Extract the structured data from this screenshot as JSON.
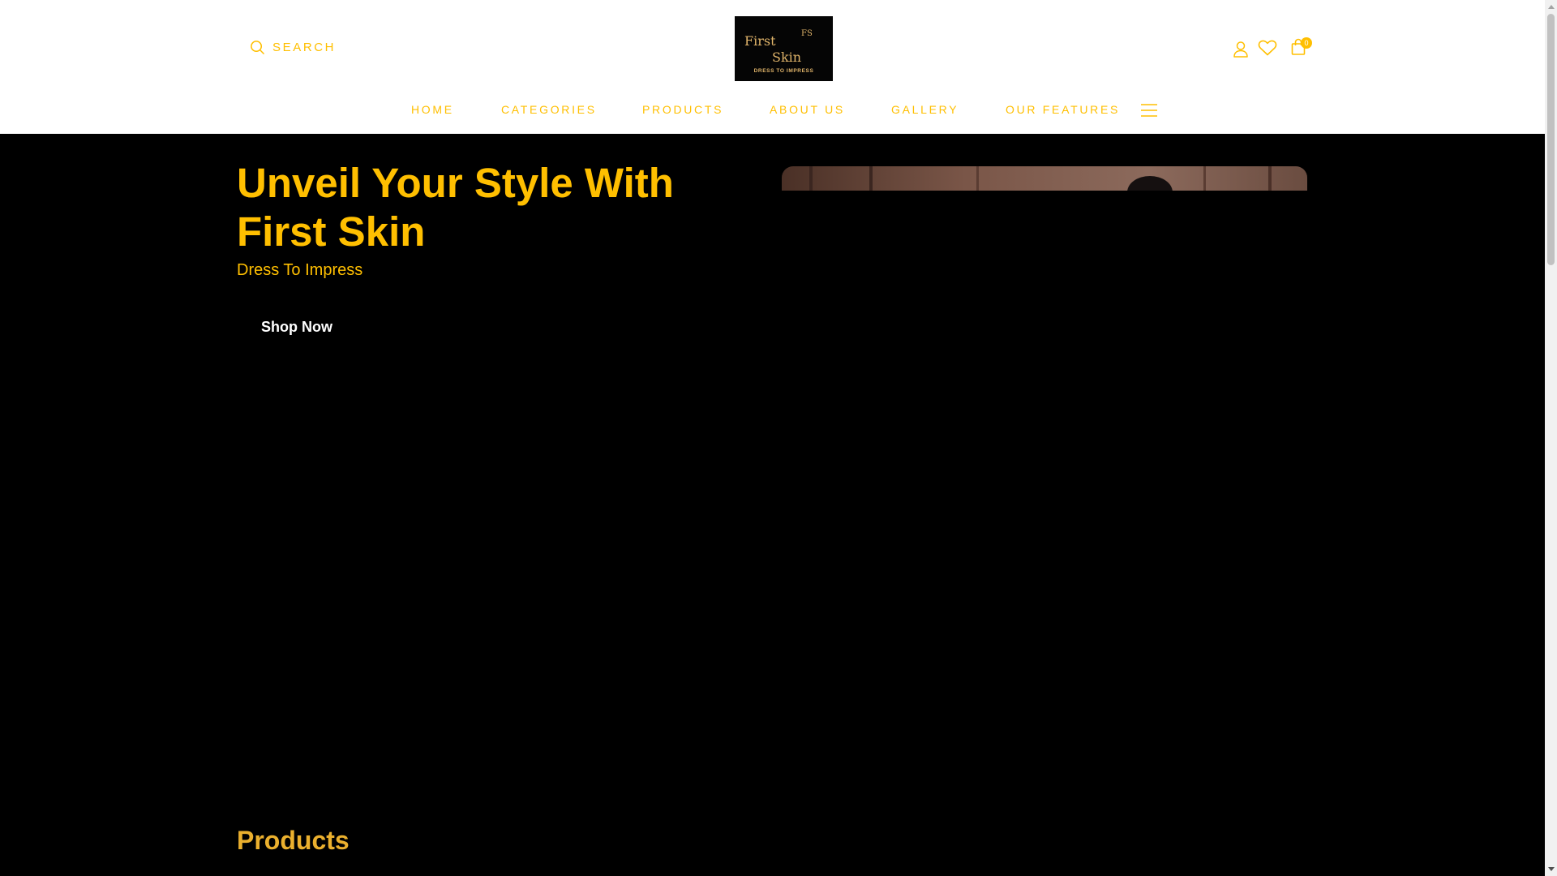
{
  "brand": {
    "accent_color": "#ffbf00",
    "logo_text_line1": "First",
    "logo_text_line2": "Skin",
    "logo_monogram": "FS",
    "logo_tagline": "DRESS TO  IMPRESS"
  },
  "header": {
    "search_label": "SEARCH",
    "cart_count": "0",
    "icons": [
      "search-icon",
      "user-icon",
      "heart-icon",
      "shopping-bag-icon",
      "hamburger-menu-icon"
    ]
  },
  "nav": {
    "items": [
      {
        "label": "HOME"
      },
      {
        "label": "CATEGORIES"
      },
      {
        "label": "PRODUCTS"
      },
      {
        "label": "ABOUT US"
      },
      {
        "label": "GALLERY"
      },
      {
        "label": "OUR FEATURES"
      }
    ]
  },
  "hero": {
    "title": "Unveil Your Style With First Skin",
    "subtitle": "Dress To Impress",
    "cta_label": "Shop Now"
  },
  "products": {
    "section_title": "Products"
  }
}
